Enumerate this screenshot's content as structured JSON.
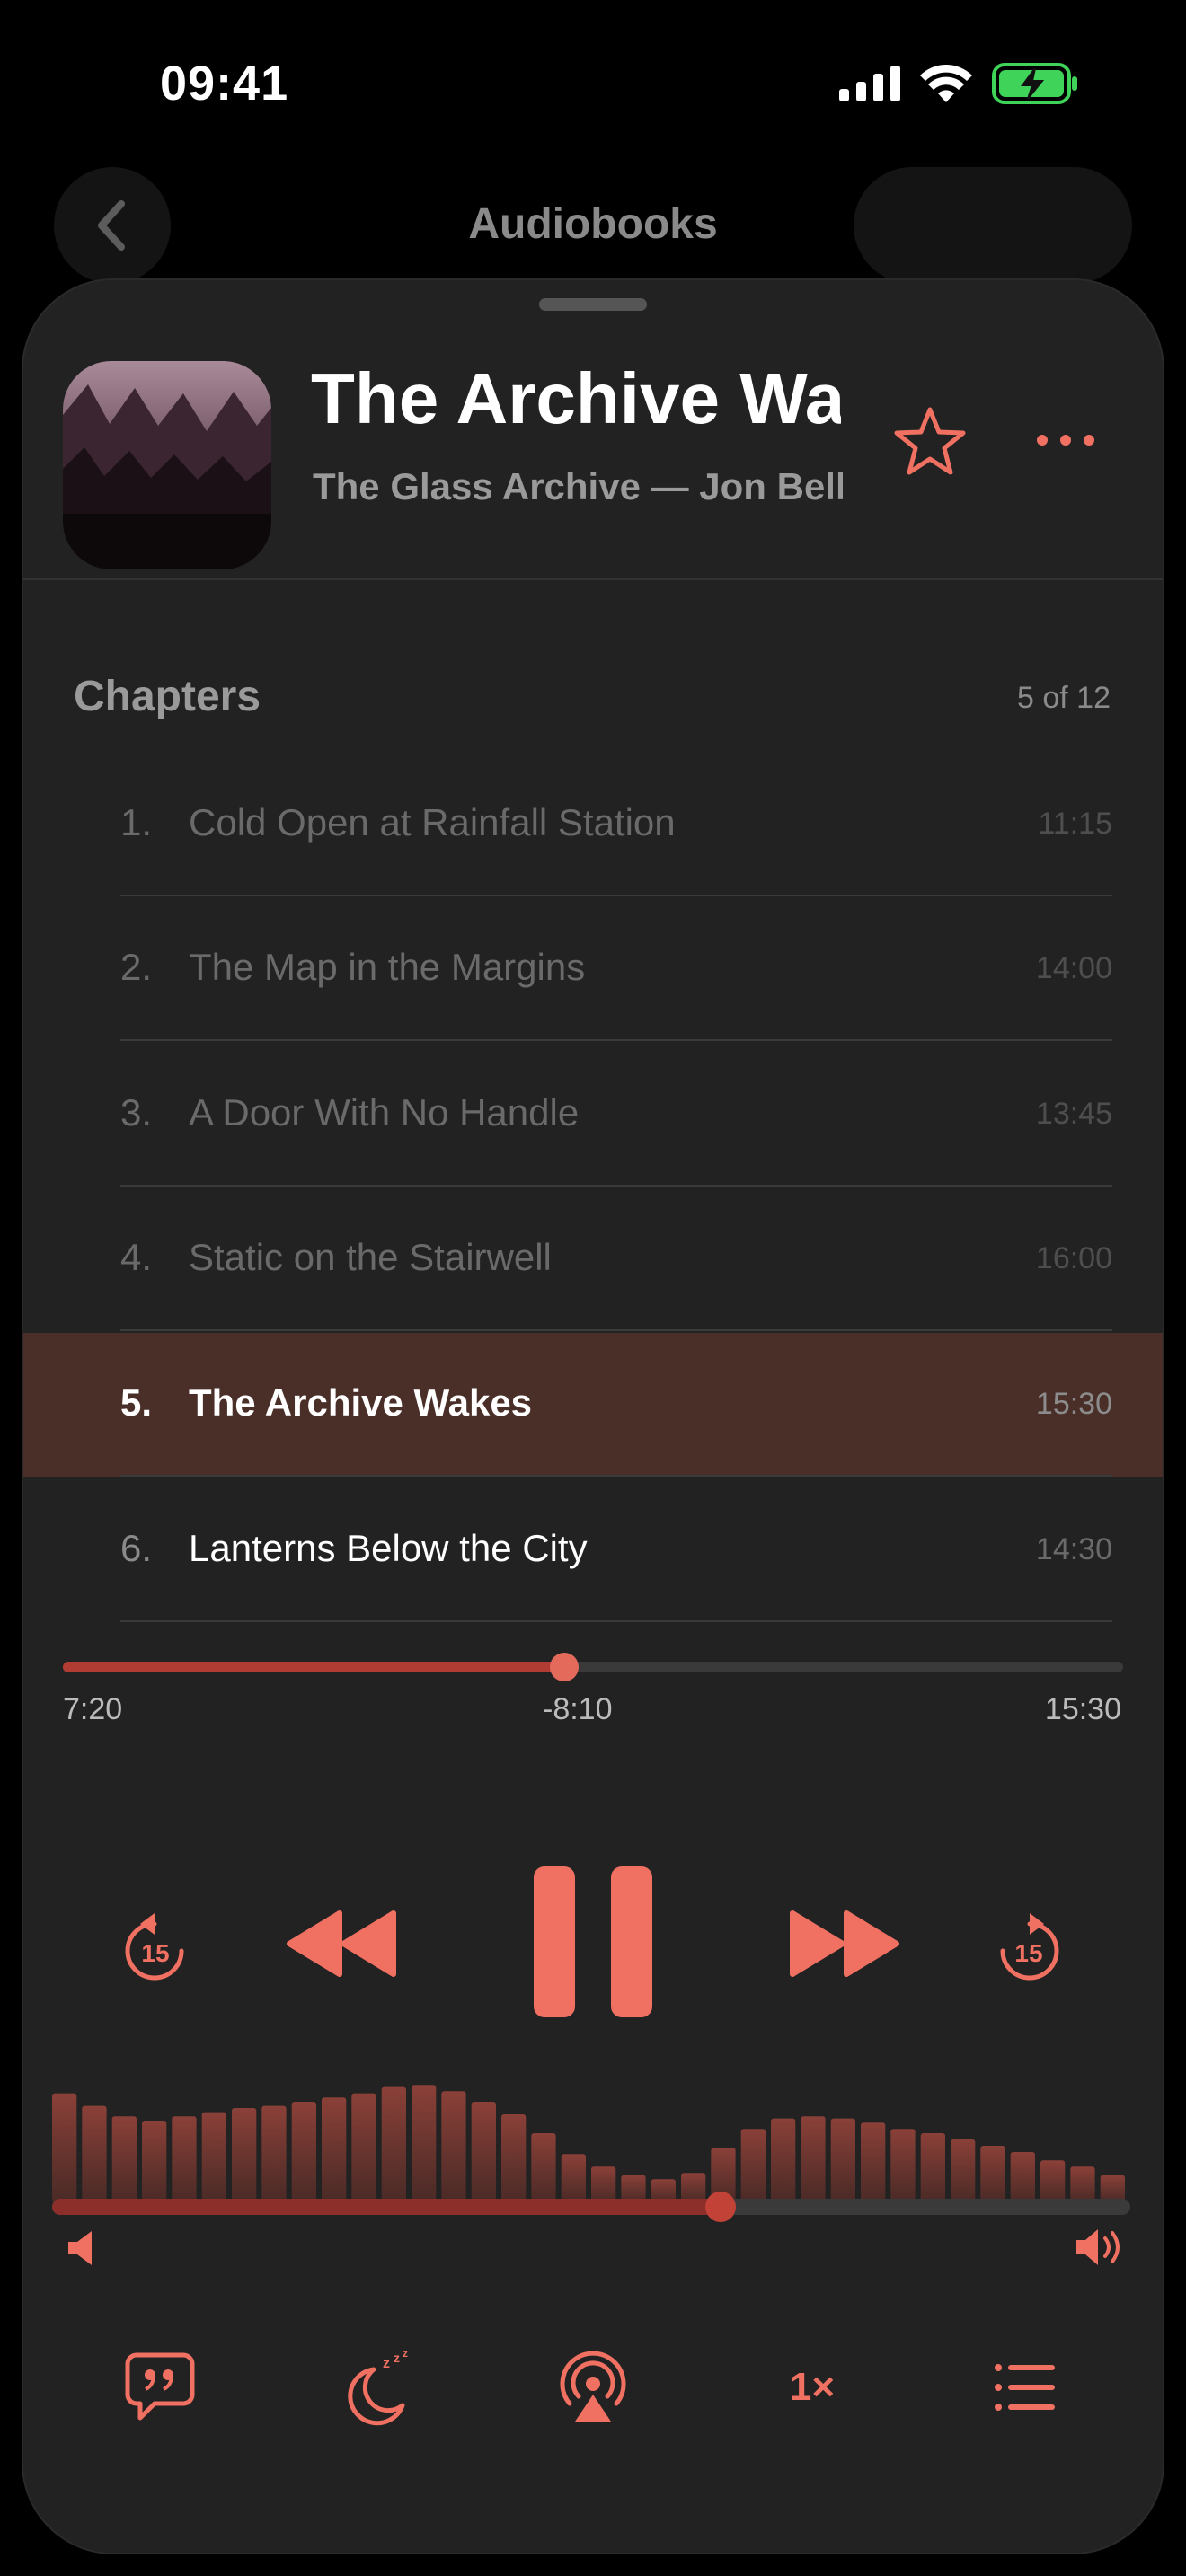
{
  "status": {
    "time": "09:41"
  },
  "nav": {
    "title": "Audiobooks"
  },
  "now_playing": {
    "title": "The Archive Wakes",
    "subtitle": "The Glass Archive — Jon Bell"
  },
  "chapters": {
    "heading": "Chapters",
    "count": "5 of 12",
    "items": [
      {
        "num": "1.",
        "title": "Cold Open at Rainfall Station",
        "duration": "11:15",
        "state": "past"
      },
      {
        "num": "2.",
        "title": "The Map in the Margins",
        "duration": "14:00",
        "state": "past"
      },
      {
        "num": "3.",
        "title": "A Door With No Handle",
        "duration": "13:45",
        "state": "past"
      },
      {
        "num": "4.",
        "title": "Static on the Stairwell",
        "duration": "16:00",
        "state": "past"
      },
      {
        "num": "5.",
        "title": "The Archive Wakes",
        "duration": "15:30",
        "state": "current"
      },
      {
        "num": "6.",
        "title": "Lanterns Below the City",
        "duration": "14:30",
        "state": "next"
      }
    ]
  },
  "progress": {
    "elapsed": "7:20",
    "remaining": "-8:10",
    "total": "15:30",
    "fraction": 0.473
  },
  "controls": {
    "skip_back": "15",
    "skip_forward": "15"
  },
  "volume": {
    "level": 0.62,
    "waveform": [
      0.52,
      0.46,
      0.41,
      0.39,
      0.41,
      0.43,
      0.45,
      0.46,
      0.48,
      0.5,
      0.52,
      0.55,
      0.56,
      0.53,
      0.48,
      0.42,
      0.33,
      0.23,
      0.17,
      0.13,
      0.11,
      0.14,
      0.26,
      0.35,
      0.4,
      0.41,
      0.4,
      0.38,
      0.35,
      0.33,
      0.3,
      0.27,
      0.24,
      0.2,
      0.17,
      0.13
    ]
  },
  "bottom": {
    "speed": "1×"
  },
  "colors": {
    "accent": "#F07062",
    "sheet": "#222222",
    "current_row": "#4A2E28"
  }
}
